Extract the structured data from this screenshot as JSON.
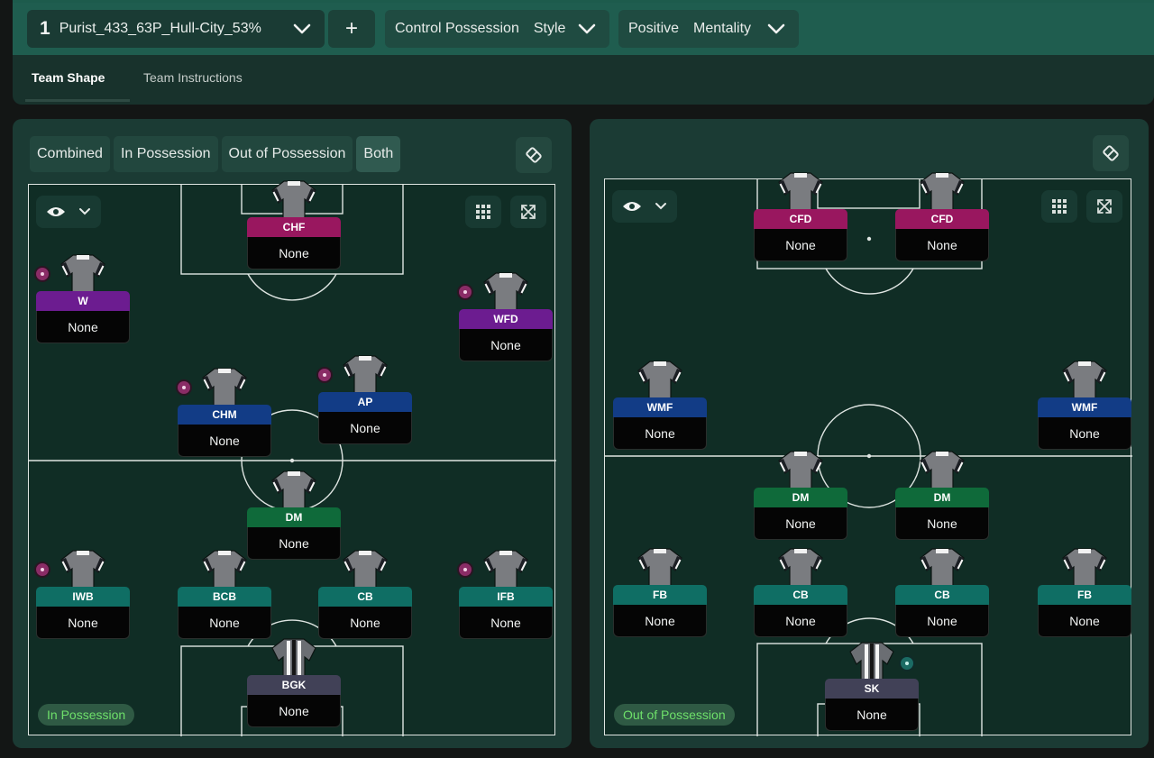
{
  "header": {
    "tactic_number": "1",
    "tactic_name": "Purist_433_63P_Hull-City_53%",
    "add_label": "+",
    "style_value": "Control Possession",
    "style_label": "Style",
    "mentality_value": "Positive",
    "mentality_label": "Mentality"
  },
  "tabs": [
    {
      "label": "Team Shape",
      "active": true
    },
    {
      "label": "Team Instructions",
      "active": false
    }
  ],
  "view_modes": [
    {
      "label": "Combined"
    },
    {
      "label": "In Possession"
    },
    {
      "label": "Out of Possession"
    },
    {
      "label": "Both",
      "active": true
    }
  ],
  "left_pitch": {
    "phase_label": "In Possession",
    "players": [
      {
        "role": "CHF",
        "name": "None",
        "group": "att",
        "dot": false
      },
      {
        "role": "W",
        "name": "None",
        "group": "wide",
        "dot": true
      },
      {
        "role": "WFD",
        "name": "None",
        "group": "wide",
        "dot": true
      },
      {
        "role": "CHM",
        "name": "None",
        "group": "mid",
        "dot": true
      },
      {
        "role": "AP",
        "name": "None",
        "group": "mid",
        "dot": true
      },
      {
        "role": "DM",
        "name": "None",
        "group": "dm",
        "dot": false
      },
      {
        "role": "IWB",
        "name": "None",
        "group": "def",
        "dot": true
      },
      {
        "role": "BCB",
        "name": "None",
        "group": "def",
        "dot": false
      },
      {
        "role": "CB",
        "name": "None",
        "group": "def",
        "dot": false
      },
      {
        "role": "IFB",
        "name": "None",
        "group": "def",
        "dot": true
      },
      {
        "role": "BGK",
        "name": "None",
        "group": "gk",
        "dot": false
      }
    ]
  },
  "right_pitch": {
    "phase_label": "Out of Possession",
    "players": [
      {
        "role": "CFD",
        "name": "None",
        "group": "att",
        "dot": false
      },
      {
        "role": "CFD",
        "name": "None",
        "group": "att",
        "dot": false
      },
      {
        "role": "WMF",
        "name": "None",
        "group": "mid",
        "dot": false
      },
      {
        "role": "WMF",
        "name": "None",
        "group": "mid",
        "dot": false
      },
      {
        "role": "DM",
        "name": "None",
        "group": "dm",
        "dot": false
      },
      {
        "role": "DM",
        "name": "None",
        "group": "dm",
        "dot": false
      },
      {
        "role": "FB",
        "name": "None",
        "group": "def",
        "dot": false
      },
      {
        "role": "CB",
        "name": "None",
        "group": "def",
        "dot": false
      },
      {
        "role": "CB",
        "name": "None",
        "group": "def",
        "dot": false
      },
      {
        "role": "FB",
        "name": "None",
        "group": "def",
        "dot": false
      },
      {
        "role": "SK",
        "name": "None",
        "group": "gk",
        "dot": true
      }
    ]
  },
  "colors": {
    "att": "#99175f",
    "wide": "#6c1c90",
    "mid": "#123c86",
    "dm": "#0f6a3a",
    "def": "#0f6e64",
    "gk": "#414157",
    "phase_text": "#6ee06a"
  },
  "icons": {
    "tactic_dropdown": "chevron-down-icon",
    "board": "tactics-board-icon",
    "visibility": "eye-icon",
    "grid": "grid-icon",
    "expand": "expand-icon"
  }
}
